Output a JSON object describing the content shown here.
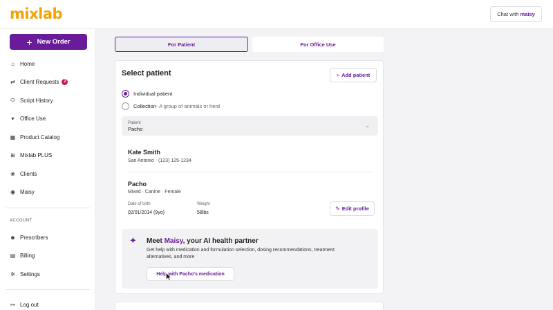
{
  "app": {
    "logo": "mixlab"
  },
  "header": {
    "chat_prefix": "Chat with",
    "chat_brand": "maisy"
  },
  "sidebar": {
    "new_order": "New Order",
    "items": [
      {
        "label": "Home",
        "icon": "home-icon",
        "glyph": "⌂"
      },
      {
        "label": "Client Requests",
        "icon": "requests-icon",
        "glyph": "⇄",
        "badge": "2"
      },
      {
        "label": "Script History",
        "icon": "pill-icon",
        "glyph": "⬭"
      },
      {
        "label": "Office Use",
        "icon": "basket-icon",
        "glyph": "▾"
      },
      {
        "label": "Product Catalog",
        "icon": "catalog-icon",
        "glyph": "▦"
      },
      {
        "label": "Mixlab PLUS",
        "icon": "plus-box-icon",
        "glyph": "⊞"
      },
      {
        "label": "Clients",
        "icon": "paw-icon",
        "glyph": "❀"
      },
      {
        "label": "Maisy",
        "icon": "chat-icon",
        "glyph": "◉"
      }
    ],
    "account_section": "ACCOUNT",
    "account_items": [
      {
        "label": "Prescribers",
        "icon": "users-icon",
        "glyph": "☻"
      },
      {
        "label": "Billing",
        "icon": "billing-icon",
        "glyph": "▤"
      },
      {
        "label": "Settings",
        "icon": "gear-icon",
        "glyph": "✲"
      }
    ],
    "logout": {
      "label": "Log out",
      "icon": "logout-icon",
      "glyph": "↦"
    }
  },
  "tabs": [
    {
      "label": "For Patient",
      "active": true
    },
    {
      "label": "For Office Use",
      "active": false
    }
  ],
  "select_patient": {
    "title": "Select patient",
    "add_button": "Add patient",
    "options": [
      {
        "label": "Individual patient",
        "sub": "",
        "selected": true
      },
      {
        "label": "Collection",
        "sub": " - A group of animals or herd",
        "selected": false
      }
    ],
    "dropdown": {
      "label": "Patient",
      "value": "Pacho"
    }
  },
  "owner": {
    "name": "Kate Smith",
    "info": "San Antonio · (123) 125-1234"
  },
  "pet": {
    "name": "Pacho",
    "info": "Mixed · Canine · Female",
    "dob_label": "Date of birth",
    "dob_value": "02/01/2014 (9yo)",
    "weight_label": "Weight",
    "weight_value": "58lbs",
    "edit_button": "Edit profile"
  },
  "maisy": {
    "title_prefix": "Meet ",
    "title_brand": "Maisy",
    "title_suffix": ", your AI health partner",
    "description": "Get help with medication and formulation selection, dosing recommendations, treatment alternatives, and more",
    "button": "Help with Pacho's medication"
  },
  "colors": {
    "brand_purple": "#6a1b9a",
    "logo_orange": "#f5a300",
    "badge": "#c2185b"
  }
}
